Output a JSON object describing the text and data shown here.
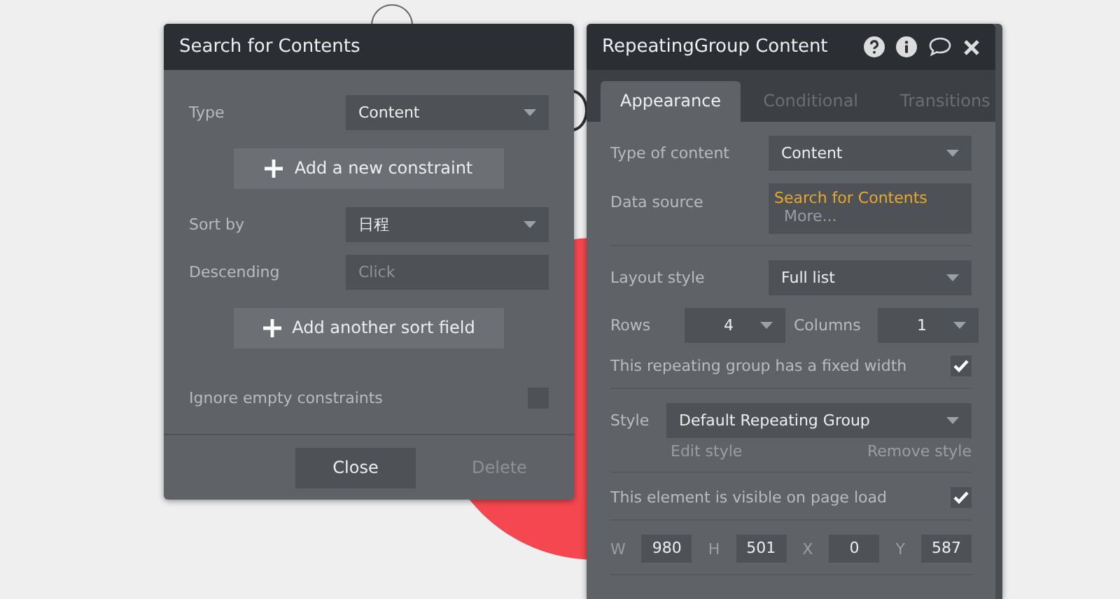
{
  "search_window": {
    "title": "Search for Contents",
    "rows": [
      {
        "kind": "dropdown",
        "label": "Type",
        "value": "Content"
      },
      {
        "kind": "button",
        "label": "Add a new constraint"
      },
      {
        "kind": "dropdown",
        "label": "Sort by",
        "value": "日程"
      },
      {
        "kind": "input",
        "label": "Descending",
        "placeholder": "Click"
      },
      {
        "kind": "button",
        "label": "Add another sort field"
      },
      {
        "kind": "checkbox",
        "label": "Ignore empty constraints",
        "checked": false
      }
    ],
    "buttons": [
      {
        "label": "Close",
        "disabled": false
      },
      {
        "label": "Delete",
        "disabled": true
      }
    ]
  },
  "property_editor": {
    "title": "RepeatingGroup Content",
    "tabs": [
      {
        "label": "Appearance",
        "selected": true
      },
      {
        "label": "Conditional",
        "selected": false
      },
      {
        "label": "Transitions",
        "selected": false
      }
    ],
    "sections": [
      [
        {
          "kind": "dropdown",
          "label": "Type of content",
          "value": "Content"
        },
        {
          "kind": "datasource",
          "label": "Data source",
          "value": "Search for Contents",
          "more": "More..."
        }
      ],
      [
        {
          "kind": "dropdown",
          "label": "Layout style",
          "value": "Full list"
        },
        {
          "kind": "pair",
          "items": [
            {
              "label": "Rows",
              "value": "4"
            },
            {
              "label": "Columns",
              "value": "1"
            }
          ]
        },
        {
          "kind": "checkbox",
          "label": "This repeating group has a fixed width",
          "checked": true
        }
      ],
      [
        {
          "kind": "style",
          "label": "Style",
          "value": "Default Repeating Group",
          "links": [
            "Edit style",
            "Remove style"
          ]
        }
      ],
      [
        {
          "kind": "checkbox",
          "label": "This element is visible on page load",
          "checked": true
        }
      ],
      [
        {
          "kind": "dims",
          "items": [
            {
              "label": "W",
              "value": "980"
            },
            {
              "label": "H",
              "value": "501"
            },
            {
              "label": "X",
              "value": "0"
            },
            {
              "label": "Y",
              "value": "587"
            }
          ]
        }
      ]
    ]
  }
}
